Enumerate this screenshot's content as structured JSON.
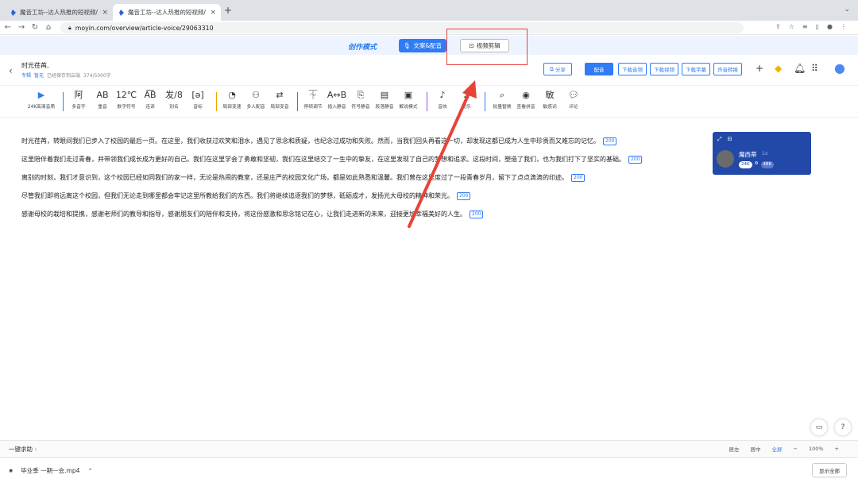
{
  "browser": {
    "tabs": [
      {
        "title": "魔音工坊--达人热推的短视频/有"
      },
      {
        "title": "魔音工坊--达人热推的短视频/有"
      }
    ],
    "url": "moyin.com/overview/article-voice/29063310"
  },
  "mode_bar": {
    "title": "创作模式",
    "text_dub_label": "文案&配音",
    "video_edit_label": "视频剪辑"
  },
  "doc": {
    "title": "时光荏苒,",
    "tag1": "专辑",
    "tag2": "暂无",
    "save_status": "已经保存到云端",
    "char_count": "374/5000字",
    "buttons": {
      "share": "分享",
      "dub": "配音",
      "download_audio": "下载音频",
      "download_video": "下载视频",
      "download_subtitle": "下载字幕",
      "voice_convert": "声音转换"
    }
  },
  "toolbar": {
    "quality": "24K高清音质",
    "items": [
      "多音字",
      "重音",
      "数字符号",
      "连读",
      "别名",
      "音标",
      "局部变速",
      "多人配音",
      "局部变音",
      "停顿调节",
      "插入静音",
      "符号静音",
      "段落静音",
      "解说模式",
      "音效",
      "配乐",
      "批量替换",
      "查看拼音",
      "敏感词",
      "评论"
    ]
  },
  "content": {
    "paragraphs": [
      {
        "text": "时光荏苒，转眼间我们已步入了校园的最后一页。在这里，我们收获过欢笑和泪水，遇见了思念和质疑，也纪念过成功和失败。然而，当我们回头再看这一切，却发现这都已成为人生中珍贵而又难忘的记忆。",
        "badge": "200"
      },
      {
        "text": "这里陪伴着我们走过青春，并带领我们成长成为更好的自己。我们在这里学会了勇敢和坚韧，我们在这里结交了一生中的挚友，在这里发现了自己的梦想和追求。这段时间，塑造了我们，也为我们打下了坚实的基础。",
        "badge": "200"
      },
      {
        "text": "离别的时刻，我们才意识到，这个校园已经如同我们的家一样，无论是热闹的教室，还是庄严的校园文化广场，都是如此熟悉和温馨。我们曾在这里度过了一段青春岁月，留下了点点滴滴的印迹。",
        "badge": "200"
      },
      {
        "text": "尽管我们即将远离这个校园，但我们无论走到哪里都会牢记这里所教给我们的东西。我们将继续追逐我们的梦想，砥砺成才，发扬光大母校的精神和荣光。",
        "badge": "200"
      },
      {
        "text": "感谢母校的栽培和提携，感谢老师们的教导和指导，感谢朋友们的陪伴和支持，将这份感激和思念铭记在心，让我们走进新的未来，迎接更加幸福美好的人生。",
        "badge": "200"
      }
    ]
  },
  "voice_card": {
    "name": "魔西蒂",
    "speed": "1x",
    "tags": [
      "24K",
      "48K"
    ]
  },
  "status_bar": {
    "help": "一键求助",
    "align_left": "居左",
    "align_center": "居中",
    "fullscreen": "全屏",
    "zoom": "100%"
  },
  "downloads": {
    "file": "毕业季 一期一会.mp4",
    "show_all": "显示全部"
  },
  "colors": {
    "accent": "#2f7cf6",
    "highlight": "#e84338",
    "voice_card": "#2349a8"
  }
}
